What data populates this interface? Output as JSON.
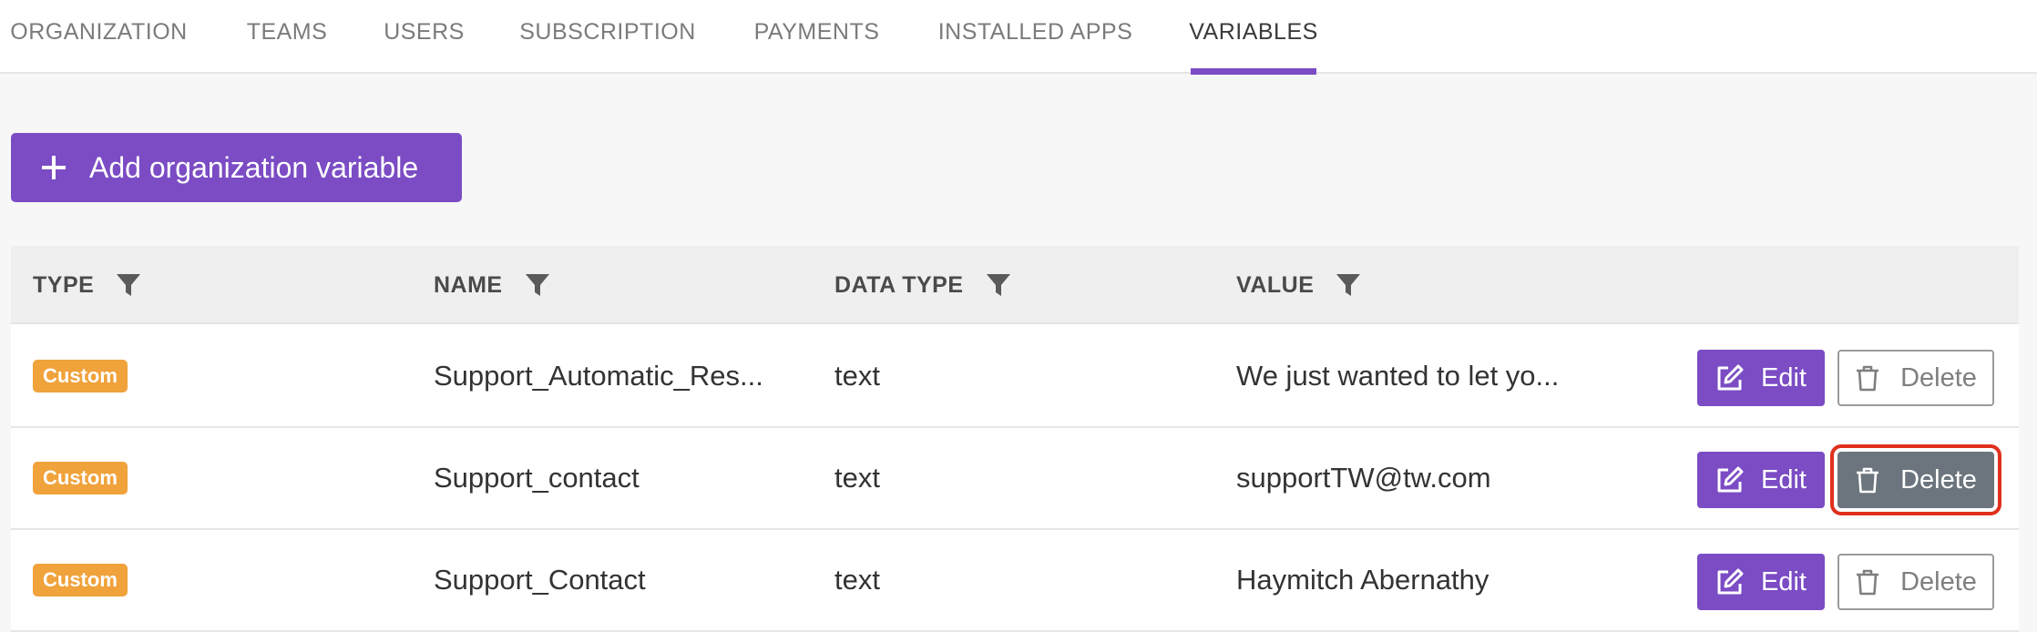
{
  "tabs": [
    {
      "label": "ORGANIZATION"
    },
    {
      "label": "TEAMS"
    },
    {
      "label": "USERS"
    },
    {
      "label": "SUBSCRIPTION"
    },
    {
      "label": "PAYMENTS"
    },
    {
      "label": "INSTALLED APPS"
    },
    {
      "label": "VARIABLES",
      "active": true
    }
  ],
  "toolbar": {
    "add_label": "Add organization variable"
  },
  "table": {
    "headers": {
      "type": "TYPE",
      "name": "NAME",
      "data_type": "DATA TYPE",
      "value": "VALUE"
    },
    "rows": [
      {
        "type": "Custom",
        "name": "Support_Automatic_Res...",
        "data_type": "text",
        "value": "We just wanted to let yo..."
      },
      {
        "type": "Custom",
        "name": "Support_contact",
        "data_type": "text",
        "value": "supportTW@tw.com"
      },
      {
        "type": "Custom",
        "name": "Support_Contact",
        "data_type": "text",
        "value": "Haymitch Abernathy"
      }
    ],
    "edit_label": "Edit",
    "delete_label": "Delete"
  },
  "colors": {
    "accent": "#7b4cc4",
    "badge": "#f0a23b",
    "delete_hover": "#6c757d",
    "highlight": "#e0301e"
  },
  "icons": {
    "add": "plus-icon",
    "filter": "filter-icon",
    "edit": "edit-icon",
    "delete": "trash-icon"
  }
}
